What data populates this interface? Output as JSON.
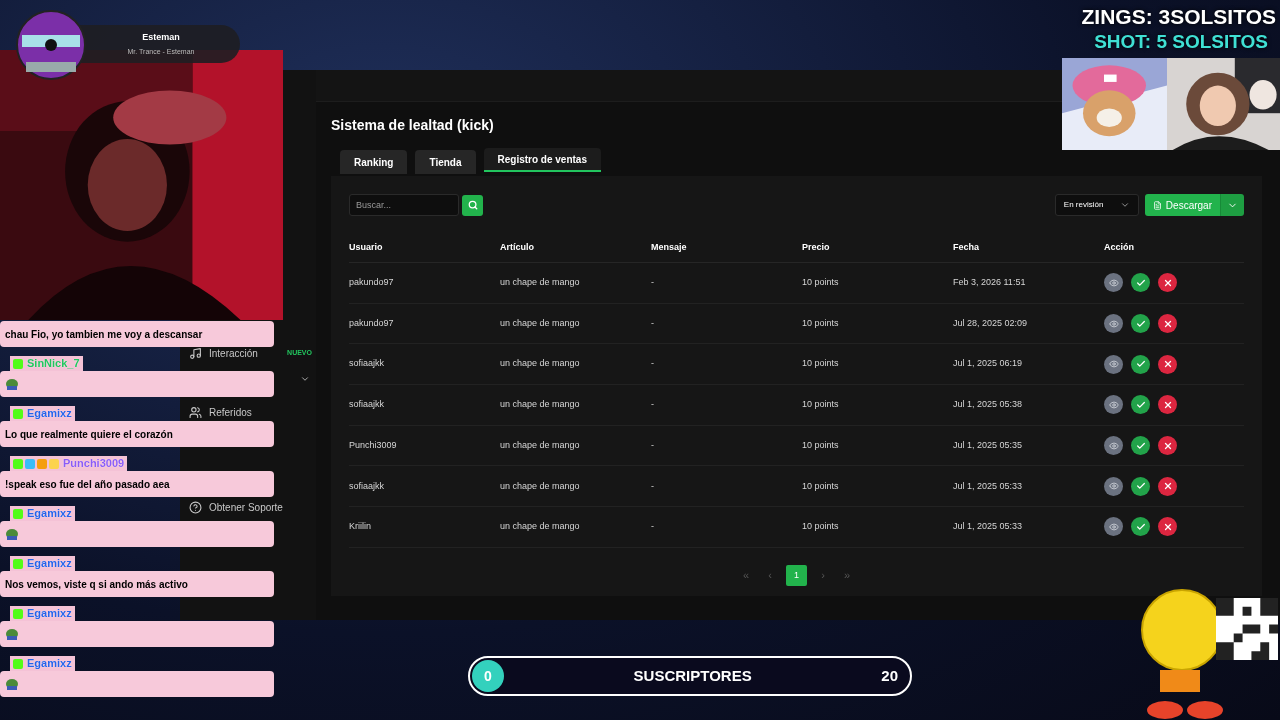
{
  "music": {
    "title": "Esteman",
    "subtitle": "Mr. Trance - Esteman"
  },
  "promo": {
    "line1": "ZINGS: 3SOLSITOS",
    "line2": "SHOT: 5 SOLSITOS"
  },
  "sidebar": {
    "items": [
      {
        "label": "Interacción",
        "badge": "NUEVO",
        "kind": "music",
        "expandable": true
      },
      {
        "label": "Referidos",
        "kind": "users"
      },
      {
        "label": "Obtener Soporte",
        "kind": "help"
      }
    ]
  },
  "page": {
    "title": "Sistema de lealtad (kick)",
    "tabs": [
      {
        "label": "Ranking",
        "selected": false
      },
      {
        "label": "Tienda",
        "selected": false
      },
      {
        "label": "Registro de ventas",
        "selected": true
      }
    ],
    "search": {
      "placeholder": "Buscar..."
    },
    "filter": {
      "value": "En revisión"
    },
    "download": {
      "label": "Descargar"
    },
    "table": {
      "columns": [
        "Usuario",
        "Artículo",
        "Mensaje",
        "Precio",
        "Fecha",
        "Acción"
      ],
      "rows": [
        {
          "user": "pakundo97",
          "item": "un chape de mango",
          "message": "-",
          "price": "10 points",
          "date": "Feb 3, 2026 11:51"
        },
        {
          "user": "pakundo97",
          "item": "un chape de mango",
          "message": "-",
          "price": "10 points",
          "date": "Jul 28, 2025 02:09"
        },
        {
          "user": "sofiaajkk",
          "item": "un chape de mango",
          "message": "-",
          "price": "10 points",
          "date": "Jul 1, 2025 06:19"
        },
        {
          "user": "sofiaajkk",
          "item": "un chape de mango",
          "message": "-",
          "price": "10 points",
          "date": "Jul 1, 2025 05:38"
        },
        {
          "user": "Punchi3009",
          "item": "un chape de mango",
          "message": "-",
          "price": "10 points",
          "date": "Jul 1, 2025 05:35"
        },
        {
          "user": "sofiaajkk",
          "item": "un chape de mango",
          "message": "-",
          "price": "10 points",
          "date": "Jul 1, 2025 05:33"
        },
        {
          "user": "Kriilin",
          "item": "un chape de mango",
          "message": "-",
          "price": "10 points",
          "date": "Jul 1, 2025 05:33"
        }
      ]
    },
    "pagination": {
      "first": "«",
      "prev": "‹",
      "pages": [
        {
          "label": "1",
          "selected": true
        }
      ],
      "next": "›",
      "last": "»"
    }
  },
  "chat": [
    {
      "kind": "text",
      "text": "chau Fio, yo tambien me voy a descansar"
    },
    {
      "kind": "emote",
      "user": "SinNick_7",
      "color": "#22c55e",
      "badges": [
        {
          "color": "#53fc18"
        }
      ]
    },
    {
      "kind": "text",
      "user": "Egamixz",
      "color": "#2563eb",
      "badges": [
        {
          "color": "#53fc18"
        }
      ],
      "text": "Lo que realmente quiere el corazón"
    },
    {
      "kind": "text",
      "user": "Punchi3009",
      "color": "#8b5cf6",
      "badges": [
        {
          "color": "#53fc18"
        },
        {
          "color": "#38bdf8"
        },
        {
          "color": "#f59e0b"
        },
        {
          "color": "#fcd34d"
        }
      ],
      "text": "!speak eso fue del año pasado aea"
    },
    {
      "kind": "emote",
      "user": "Egamixz",
      "color": "#2563eb",
      "badges": [
        {
          "color": "#53fc18"
        }
      ]
    },
    {
      "kind": "text",
      "user": "Egamixz",
      "color": "#2563eb",
      "badges": [
        {
          "color": "#53fc18"
        }
      ],
      "text": "Nos vemos, viste q si ando más activo"
    },
    {
      "kind": "emote",
      "user": "Egamixz",
      "color": "#2563eb",
      "badges": [
        {
          "color": "#53fc18"
        }
      ]
    },
    {
      "kind": "emote",
      "user": "Egamixz",
      "color": "#2563eb",
      "badges": [
        {
          "color": "#53fc18"
        }
      ]
    }
  ],
  "goal": {
    "current": "0",
    "label": "SUSCRIPTORES",
    "target": "20",
    "level": 0
  }
}
